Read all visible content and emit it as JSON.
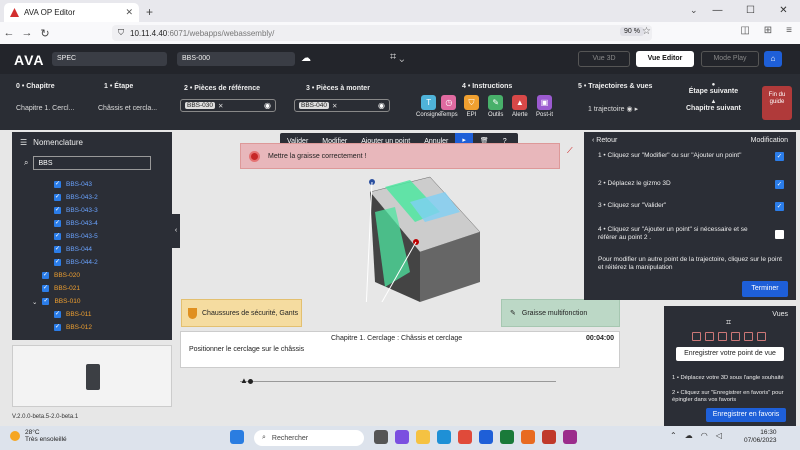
{
  "browser": {
    "tab_title": "AVA OP Editor",
    "url_host": "10.11.4.40",
    "url_path": ":6071/webapps/webassembly/",
    "zoom": "90 %"
  },
  "header": {
    "logo": "AVA",
    "spec": "SPEC",
    "bbs": "BBS-000",
    "vue3d": "Vue 3D",
    "vue_editor": "Vue Editor",
    "mode_play": "Mode Play"
  },
  "toolbar": {
    "chapitre_label": "0 • Chapitre",
    "chapitre_value": "Chapitre 1. Cercl...",
    "etape_label": "1 • Étape",
    "etape_value": "Châssis et cercla...",
    "ref_label": "2 • Pièces de référence",
    "ref_chip": "BBS-030",
    "monter_label": "3 • Pièces à monter",
    "monter_chip": "BBS-040",
    "instructions_label": "4 • Instructions",
    "instructions": [
      {
        "label": "Consigne",
        "color": "#4fb3d9",
        "glyph": "T"
      },
      {
        "label": "Temps",
        "color": "#e06aa0",
        "glyph": "◷"
      },
      {
        "label": "EPI",
        "color": "#f0a030",
        "glyph": "⛉"
      },
      {
        "label": "Outils",
        "color": "#48b06a",
        "glyph": "✎"
      },
      {
        "label": "Alerte",
        "color": "#d84848",
        "glyph": "▲"
      },
      {
        "label": "Post-it",
        "color": "#9b5ad0",
        "glyph": "▣"
      }
    ],
    "traj_label": "5 • Trajectoires & vues",
    "traj_value": "1 trajectoire",
    "etape_suivante": "Étape suivante",
    "chapitre_suivant": "Chapitre suivant",
    "fin_guide": "Fin du guide"
  },
  "nomenclature": {
    "title": "Nomenclature",
    "search_value": "BBS",
    "items": [
      {
        "label": "BBS-043",
        "indent": 2,
        "color": "#6aa3ff"
      },
      {
        "label": "BBS-043-2",
        "indent": 2,
        "color": "#6aa3ff"
      },
      {
        "label": "BBS-043-3",
        "indent": 2,
        "color": "#6aa3ff"
      },
      {
        "label": "BBS-043-4",
        "indent": 2,
        "color": "#6aa3ff"
      },
      {
        "label": "BBS-043-5",
        "indent": 2,
        "color": "#6aa3ff"
      },
      {
        "label": "BBS-044",
        "indent": 2,
        "color": "#6aa3ff"
      },
      {
        "label": "BBS-044-2",
        "indent": 2,
        "color": "#6aa3ff"
      },
      {
        "label": "BBS-020",
        "indent": 1,
        "color": "#f0a030"
      },
      {
        "label": "BBS-021",
        "indent": 1,
        "color": "#f0a030"
      },
      {
        "label": "BBS-010",
        "indent": 1,
        "color": "#f0a030"
      },
      {
        "label": "BBS-011",
        "indent": 2,
        "color": "#f0a030"
      },
      {
        "label": "BBS-012",
        "indent": 2,
        "color": "#f0a030"
      }
    ]
  },
  "edit_toolbar": {
    "valider": "Valider",
    "modifier": "Modifier",
    "ajouter": "Ajouter un point",
    "annuler": "Annuler"
  },
  "alert_text": "Mettre la graisse correctement !",
  "epi_card": "Chaussures de sécurité, Gants",
  "tool_card": "Graisse multifonction",
  "step": {
    "title": "Chapitre 1. Cerclage : Châssis et cerclage",
    "time": "00:04:00",
    "desc": "Positionner le cerclage sur le châssis"
  },
  "right_panel": {
    "retour": "Retour",
    "modification": "Modification",
    "items": [
      {
        "text": "1 • Cliquez sur \"Modifier\" ou sur \"Ajouter un point\"",
        "checked": true
      },
      {
        "text": "2 • Déplacez le gizmo 3D",
        "checked": true
      },
      {
        "text": "3 • Cliquez sur \"Valider\"",
        "checked": true
      },
      {
        "text": "4 • Cliquez sur \"Ajouter un point\" si nécessaire et se référer au point 2 .",
        "checked": false
      }
    ],
    "note": "Pour modifier un autre point de la trajectoire, cliquez sur le point et réitérez la manipulation",
    "terminer": "Terminer"
  },
  "vues_panel": {
    "title": "Vues",
    "register": "Enregistrer votre point de vue",
    "note1": "1 • Déplacez votre 3D sous l'angle souhaité",
    "note2": "2 • Cliquez sur \"Enregistrer en favoris\" pour épingler dans vos favoris",
    "favoris": "Enregistrer en favoris"
  },
  "version": "V.2.0.0-beta.5-2.0-beta.1",
  "taskbar": {
    "temp": "28°C",
    "weather": "Très ensoleillé",
    "search_placeholder": "Rechercher",
    "time": "16:30",
    "date": "07/06/2023"
  }
}
